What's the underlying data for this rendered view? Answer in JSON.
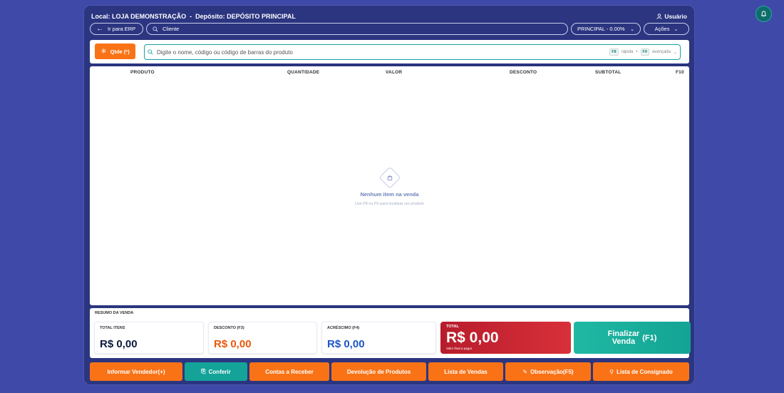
{
  "header": {
    "local_label": "Local: LOJA DEMONSTRAÇÃO",
    "separator": "-",
    "deposit_label": "Depósito: DEPÓSITO PRINCIPAL",
    "user_label": "Usuário"
  },
  "toolbar": {
    "erp_button": "Ir para ERP",
    "client_placeholder": "Cliente",
    "price_table": "PRINCIPAL - 0.00%",
    "actions_label": "Ações"
  },
  "product_search": {
    "qty_button": "Qtde (*)",
    "placeholder": "Digite o nome, código ou código de barras do produto",
    "key_fast": "F8",
    "fast_label": "rápida",
    "dot": "•",
    "key_advanced": "F9",
    "advanced_label": "avançada"
  },
  "table": {
    "columns": [
      "PRODUTO",
      "QUANTIDADE",
      "VALOR",
      "DESCONTO",
      "SUBTOTAL",
      "F10"
    ],
    "empty_title": "Nenhum item na venda",
    "empty_subtitle": "Use F8 ou F9 para localizar um produto"
  },
  "summary": {
    "title": "RESUMO DA VENDA",
    "total_items_label": "TOTAL ITENS",
    "total_items_value": "R$ 0,00",
    "discount_label": "DESCONTO (F3)",
    "discount_value": "R$ 0,00",
    "surcharge_label": "ACRÉSCIMO (F4)",
    "surcharge_value": "R$ 0,00",
    "total_label": "TOTAL",
    "total_value": "R$ 0,00",
    "total_sub": "Valor final a pagar",
    "finalize_line1": "Finalizar",
    "finalize_line2": "Venda",
    "finalize_key": "(F1)"
  },
  "bottom_buttons": {
    "seller": "Informar Vendedor(+)",
    "check": "Conferir",
    "receivables": "Contas a Receber",
    "returns": "Devolução de Produtos",
    "sales_list": "Lista de Vendas",
    "note": "Observação(F5)",
    "consigned_list": "Lista de Consignado"
  },
  "colors": {
    "background": "#3f4aa8",
    "window": "#2b3580",
    "orange": "#f97316",
    "teal": "#14a399",
    "total_red": "#c62532",
    "discount_value": "#e8590c",
    "surcharge_value": "#1e56c5"
  }
}
